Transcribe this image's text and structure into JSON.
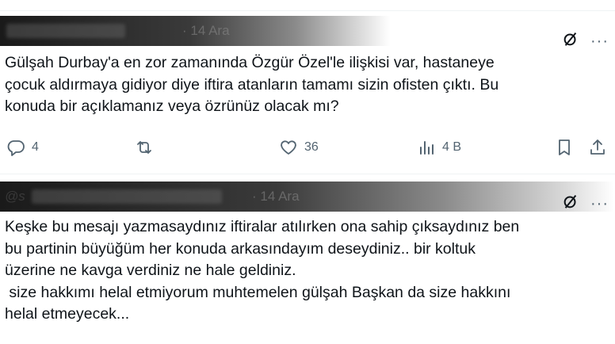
{
  "tweets": [
    {
      "timestamp": "· 14 Ara",
      "text": "Gülşah Durbay'a en zor zamanında Özgür Özel'le ilişkisi var, hastaneye\nçocuk aldırmaya gidiyor diye iftira atanların tamamı sizin ofisten çıktı. Bu\nkonuda bir açıklamanız veya özrünüz olacak mı?",
      "replies": "4",
      "reposts": "",
      "likes": "36",
      "views": "4 B",
      "more": "···"
    },
    {
      "handle_fragment": "@s",
      "timestamp": "· 14 Ara",
      "text": "Keşke bu mesajı yazmasaydınız iftiralar atılırken ona sahip çıksaydınız ben\nbu partinin büyüğüm her konuda arkasındayım deseydiniz.. bir koltuk\nüzerine ne kavga verdiniz ne hale geldiniz.\n size hakkımı helal etmiyorum muhtemelen gülşah Başkan da size hakkını\nhelal etmeyecek...",
      "more": "···"
    }
  ],
  "icons": {
    "reply": "reply-icon",
    "repost": "repost-icon",
    "like": "heart-icon",
    "views": "views-icon",
    "bookmark": "bookmark-icon",
    "share": "share-icon",
    "grok": "grok-icon",
    "more": "more-icon"
  },
  "colors": {
    "text": "#0f1419",
    "muted": "#536471",
    "divider": "#eff3f4"
  }
}
